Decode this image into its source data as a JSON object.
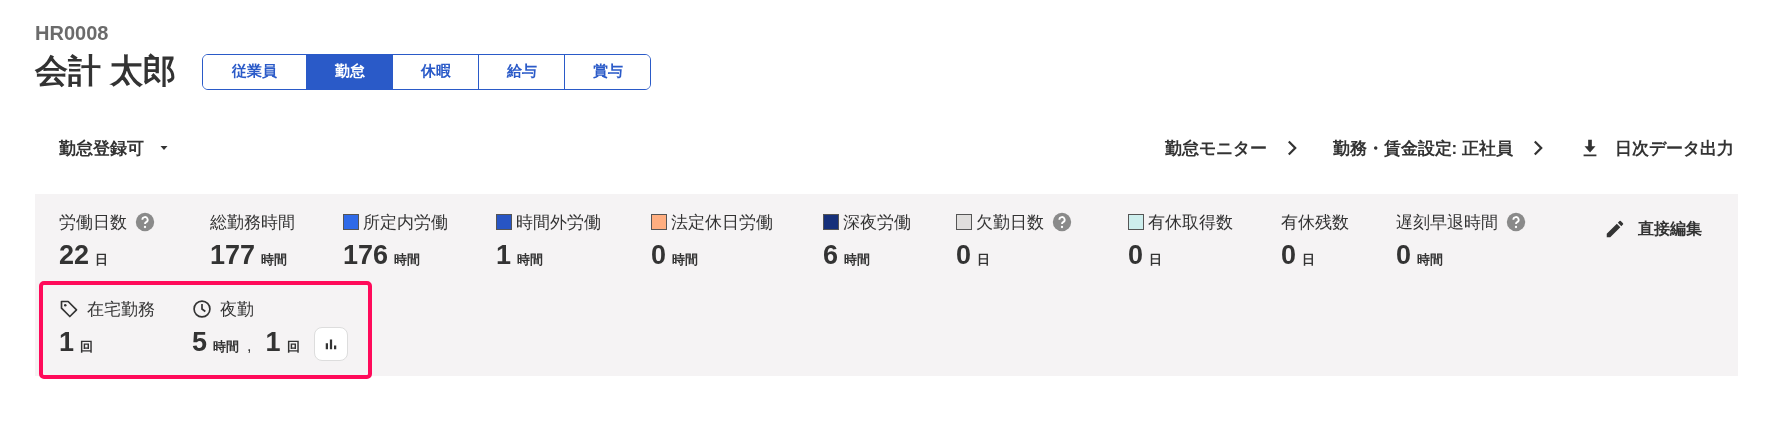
{
  "employee": {
    "code": "HR0008",
    "name": "会計 太郎"
  },
  "tabs": [
    {
      "label": "従業員",
      "selected": false
    },
    {
      "label": "勤怠",
      "selected": true
    },
    {
      "label": "休暇",
      "selected": false
    },
    {
      "label": "給与",
      "selected": false
    },
    {
      "label": "賞与",
      "selected": false
    }
  ],
  "toolbar": {
    "status_dropdown": "勤怠登録可",
    "links": [
      {
        "label": "勤怠モニター"
      },
      {
        "label": "勤務・賃金設定: 正社員"
      }
    ],
    "export_button": "日次データ出力"
  },
  "stats": [
    {
      "label": "労働日数",
      "help": true,
      "value": "22",
      "unit": "日"
    },
    {
      "label": "総勤務時間",
      "help": false,
      "value": "177",
      "unit": "時間"
    },
    {
      "label": "所定内労働",
      "help": false,
      "color": "#2f6ae8",
      "value": "176",
      "unit": "時間"
    },
    {
      "label": "時間外労働",
      "help": false,
      "color": "#2855c4",
      "value": "1",
      "unit": "時間"
    },
    {
      "label": "法定休日労働",
      "help": false,
      "color": "#ffae80",
      "value": "0",
      "unit": "時間"
    },
    {
      "label": "深夜労働",
      "help": false,
      "color": "#16307a",
      "value": "6",
      "unit": "時間"
    },
    {
      "label": "欠勤日数",
      "help": true,
      "color": "#e0dedd",
      "value": "0",
      "unit": "日"
    },
    {
      "label": "有休取得数",
      "help": false,
      "color": "#cdeeed",
      "value": "0",
      "unit": "日"
    },
    {
      "label": "有休残数",
      "help": false,
      "value": "0",
      "unit": "日"
    },
    {
      "label": "遅刻早退時間",
      "help": true,
      "value": "0",
      "unit": "時間"
    }
  ],
  "edit_button": "直接編集",
  "extra_stats": {
    "highlighted": true,
    "items": [
      {
        "kind": "tag",
        "label": "在宅勤務",
        "parts": [
          {
            "value": "1",
            "unit": "回"
          }
        ],
        "chart_button": false
      },
      {
        "kind": "clock",
        "label": "夜勤",
        "parts": [
          {
            "value": "5",
            "unit": "時間"
          },
          {
            "value": "1",
            "unit": "回"
          }
        ],
        "separator": ",",
        "chart_button": true
      }
    ]
  }
}
